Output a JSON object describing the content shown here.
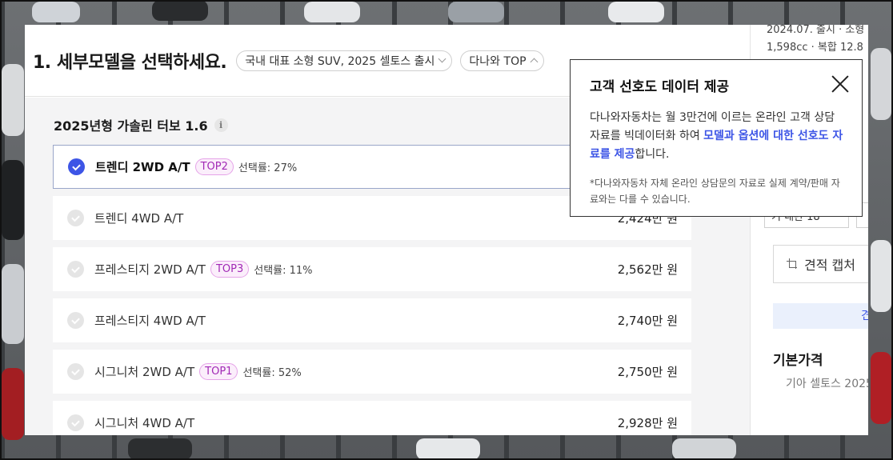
{
  "header": {
    "title": "1. 세부모델을 선택하세요.",
    "chips": [
      {
        "label": "국내 대표 소형 SUV, 2025 셀토스 출시"
      },
      {
        "label": "다나와 TOP"
      }
    ]
  },
  "section": {
    "title": "2025년형 가솔린 터보 1.6",
    "info_glyph": "i"
  },
  "trims": [
    {
      "name": "트렌디 2WD A/T",
      "badge": "TOP2",
      "rate": "선택률: 27%",
      "price": "",
      "selected": true
    },
    {
      "name": "트렌디 4WD A/T",
      "badge": "",
      "rate": "",
      "price": "2,424만 원",
      "selected": false
    },
    {
      "name": "프레스티지 2WD A/T",
      "badge": "TOP3",
      "rate": "선택률: 11%",
      "price": "2,562만 원",
      "selected": false
    },
    {
      "name": "프레스티지 4WD A/T",
      "badge": "",
      "rate": "",
      "price": "2,740만 원",
      "selected": false
    },
    {
      "name": "시그니처 2WD A/T",
      "badge": "TOP1",
      "rate": "선택률: 52%",
      "price": "2,750만 원",
      "selected": false
    },
    {
      "name": "시그니처 4WD A/T",
      "badge": "",
      "rate": "",
      "price": "2,928만 원",
      "selected": false
    }
  ],
  "side": {
    "meta_line1": "2024.07. 출시 · 소형",
    "meta_line2": "1,598cc · 복합 12.8",
    "btn1": "기 내관 18",
    "btn2": "",
    "capture_label": "견적 캡처",
    "blue_label": "견",
    "base_price_title": "기본가격",
    "base_price_sub": "기아 셀토스 2025"
  },
  "popup": {
    "title": "고객 선호도 데이터 제공",
    "body_plain_1": "다나와자동차는 월 3만건에 이르는 온라인 고객 상담자료를 빅데이터화 하여 ",
    "body_highlight": "모델과 옵션에 대한 선호도 자료를 제공",
    "body_plain_2": "합니다.",
    "note": "*다나와자동차 자체 온라인 상담문의 자료로 실제 계약/판매 자료와는 다를 수 있습니다."
  },
  "colors": {
    "accent": "#3d55e6",
    "badge_text": "#a129b5",
    "badge_bg": "#fbeefb"
  }
}
